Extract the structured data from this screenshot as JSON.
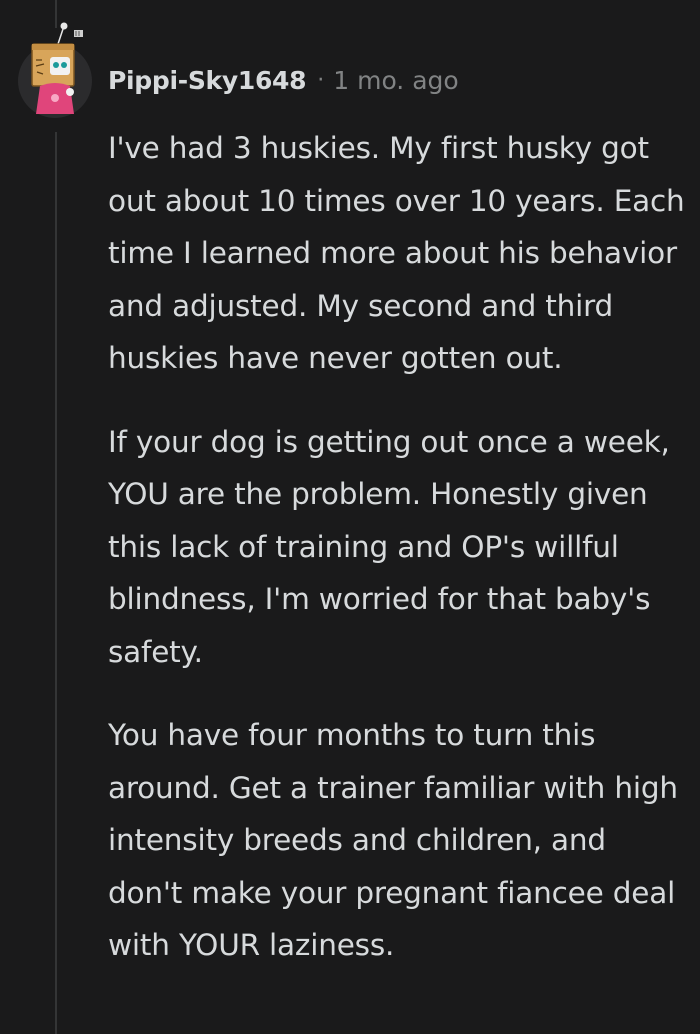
{
  "comment": {
    "author": "Pippi-Sky1648",
    "separator": "·",
    "timestamp": "1 mo. ago",
    "avatar_icon": "snoo-box-head-avatar-icon",
    "paragraphs": [
      "I've had 3 huskies. My first husky got out about 10 times over 10 years. Each time I learned more about his behavior and adjusted. My second and third huskies have never gotten out.",
      "If your dog is getting out once a week, YOU are the problem. Honestly given this lack of training and OP's willful blindness, I'm worried for that baby's safety.",
      "You have four months to turn this around. Get a trainer familiar with high intensity breeds and children, and don't make your pregnant fiancee deal with YOUR laziness."
    ]
  },
  "colors": {
    "background": "#1a1a1b",
    "text": "#d7dadc",
    "meta_text": "#818384",
    "thread_line": "#343536"
  }
}
